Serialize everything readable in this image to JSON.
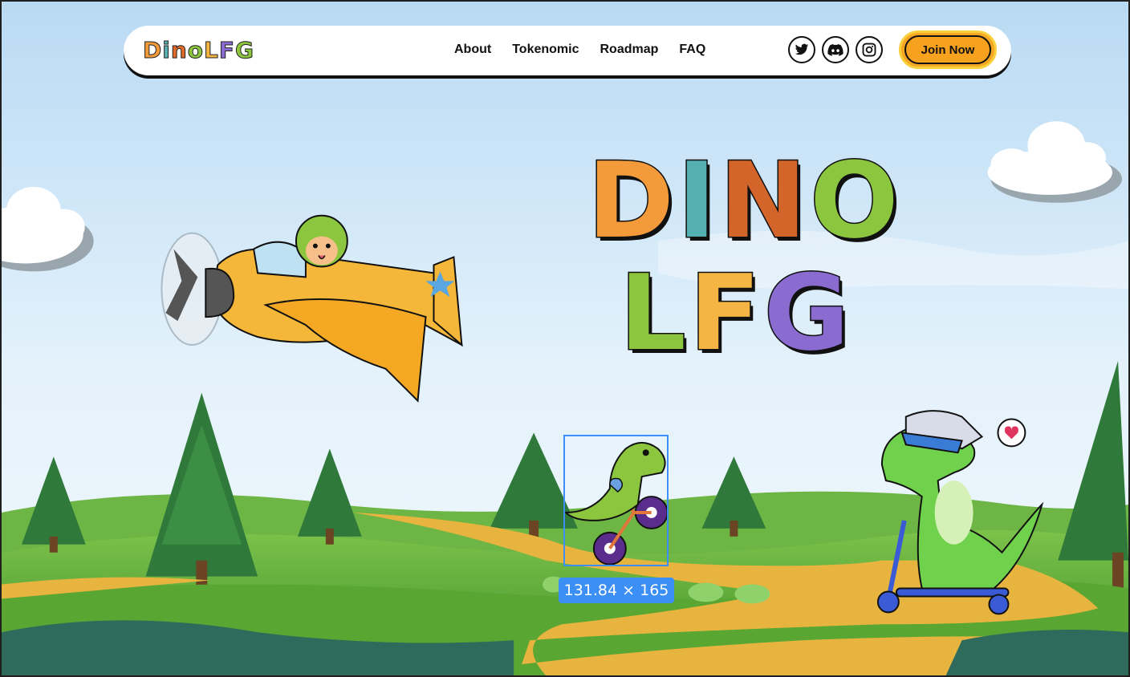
{
  "logo": {
    "letters": [
      "D",
      "i",
      "n",
      "o",
      "L",
      "F",
      "G"
    ],
    "colors": [
      "#f39b3a",
      "#5bb1b2",
      "#e06a2a",
      "#8cc63f",
      "#f4b544",
      "#8a6cd1",
      "#8cc63f"
    ]
  },
  "nav": {
    "items": [
      "About",
      "Tokenomic",
      "Roadmap",
      "FAQ"
    ]
  },
  "socials": [
    "twitter-icon",
    "discord-icon",
    "instagram-icon"
  ],
  "cta": {
    "label": "Join Now"
  },
  "hero": {
    "line1": [
      "D",
      "I",
      "N",
      "O"
    ],
    "line1_colors": [
      "#f39b3a",
      "#55b0b3",
      "#d4652a",
      "#8cc63f"
    ],
    "line2": [
      "L",
      "F",
      "G"
    ],
    "line2_colors": [
      "#8cc63f",
      "#f4b544",
      "#8a6cd1"
    ]
  },
  "inspector": {
    "dimensions": "131.84 × 165"
  },
  "colors": {
    "sky": "#cfe8fa",
    "grass": "#5aa632",
    "path": "#e6b43f",
    "accent": "#f5a623"
  }
}
